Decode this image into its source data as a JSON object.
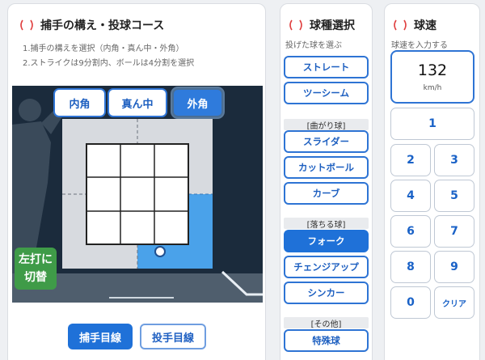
{
  "course_panel": {
    "title": "捕手の構え・投球コース",
    "hint1": "1.捕手の構えを選択（内角・真ん中・外角）",
    "hint2": "2.ストライクは9分割内、ボールは4分割を選択",
    "stance_tabs": [
      {
        "label": "内角",
        "selected": false
      },
      {
        "label": "真ん中",
        "selected": false
      },
      {
        "label": "外角",
        "selected": true
      }
    ],
    "batter_switch_line1": "左打に",
    "batter_switch_line2": "切替",
    "view_buttons": [
      {
        "label": "捕手目線",
        "selected": true
      },
      {
        "label": "投手目線",
        "selected": false
      }
    ]
  },
  "type_panel": {
    "title": "球種選択",
    "hint": "投げた球を選ぶ",
    "groups": [
      {
        "category": "",
        "items": [
          "ストレート",
          "ツーシーム"
        ]
      },
      {
        "category": "[曲がり球]",
        "items": [
          "スライダー",
          "カットボール",
          "カーブ"
        ]
      },
      {
        "category": "[落ちる球]",
        "items": [
          "フォーク",
          "チェンジアップ",
          "シンカー"
        ]
      },
      {
        "category": "[その他]",
        "items": [
          "特殊球"
        ]
      }
    ],
    "selected": "フォーク"
  },
  "speed_panel": {
    "title": "球速",
    "hint": "球速を入力する",
    "value": "132",
    "unit": "km/h",
    "keys": [
      "1",
      "2",
      "3",
      "4",
      "5",
      "6",
      "7",
      "8",
      "9",
      "0",
      "クリア"
    ]
  },
  "colors": {
    "accent": "#1f71d8",
    "selected_zone": "#4aa2ea",
    "stage_bg": "#1b2b3c",
    "switch_green": "#3f9b48"
  }
}
